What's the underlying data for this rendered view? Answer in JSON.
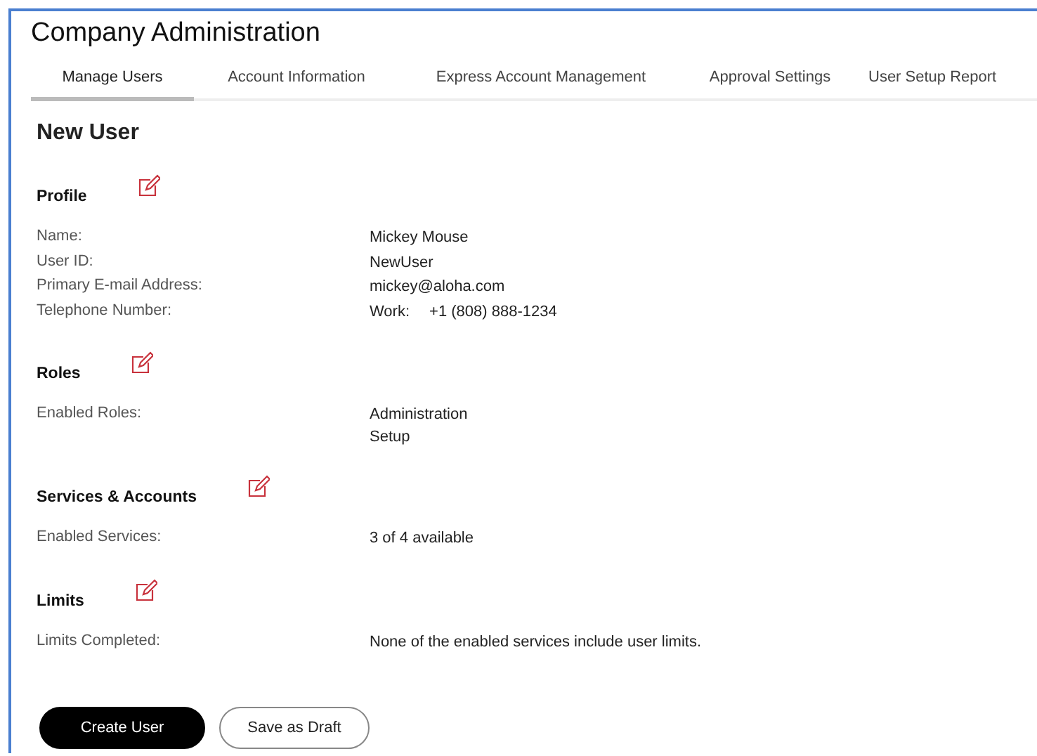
{
  "title": "Company Administration",
  "tabs": [
    {
      "label": "Manage Users",
      "selected": true
    },
    {
      "label": "Account Information",
      "selected": false
    },
    {
      "label": "Express Account Management",
      "selected": false
    },
    {
      "label": "Approval Settings",
      "selected": false
    },
    {
      "label": "User Setup Report",
      "selected": false
    }
  ],
  "heading": "New User",
  "sections": [
    {
      "title": "Profile",
      "rows": [
        {
          "label": "Name:",
          "values": [
            "Mickey Mouse"
          ]
        },
        {
          "label": "User ID:",
          "values": [
            "NewUser"
          ]
        },
        {
          "label": "Primary E-mail Address:",
          "values": [
            "mickey@aloha.com"
          ]
        },
        {
          "label": "Telephone Number:",
          "prefix": "Work:",
          "values": [
            "+1 (808) 888-1234"
          ]
        }
      ]
    },
    {
      "title": "Roles",
      "rows": [
        {
          "label": "Enabled Roles:",
          "values": [
            "Administration",
            "Setup"
          ]
        }
      ]
    },
    {
      "title": "Services & Accounts",
      "rows": [
        {
          "label": "Enabled Services:",
          "values": [
            "3 of 4 available"
          ]
        }
      ]
    },
    {
      "title": "Limits",
      "rows": [
        {
          "label": "Limits Completed:",
          "values": [
            "None of the enabled services include user limits."
          ]
        }
      ]
    }
  ],
  "buttons": [
    {
      "label": "Create User",
      "kind": "primary"
    },
    {
      "label": "Save as Draft",
      "kind": "secondary"
    }
  ]
}
